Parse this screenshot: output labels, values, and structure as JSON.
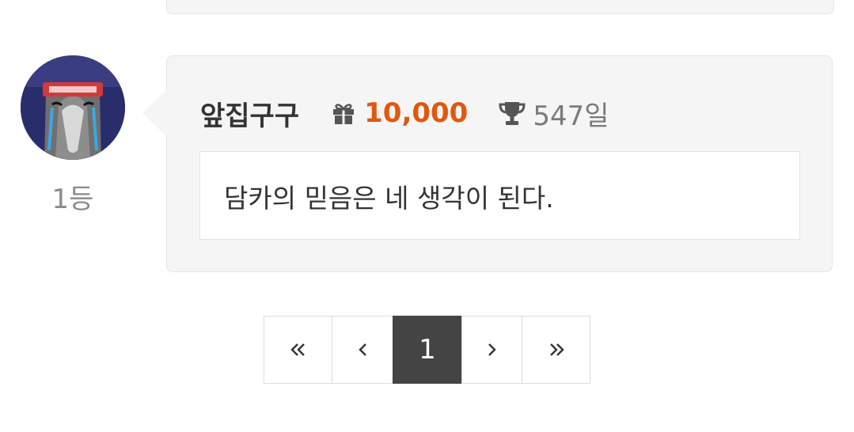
{
  "comment": {
    "rank_label": "1등",
    "username": "앞집구구",
    "points": "10,000",
    "days": "547일",
    "message": "담카의 믿음은 네 생각이 된다.",
    "avatar_icon": "avatar-image",
    "points_icon": "gift-icon",
    "days_icon": "trophy-icon"
  },
  "pagination": {
    "first_icon": "double-chevron-left-icon",
    "prev_icon": "chevron-left-icon",
    "current_page": "1",
    "next_icon": "chevron-right-icon",
    "last_icon": "double-chevron-right-icon"
  },
  "colors": {
    "points": "#e2570f",
    "card_bg": "#f5f5f5",
    "current_page_bg": "#444444",
    "muted_text": "#7a7a7a"
  }
}
